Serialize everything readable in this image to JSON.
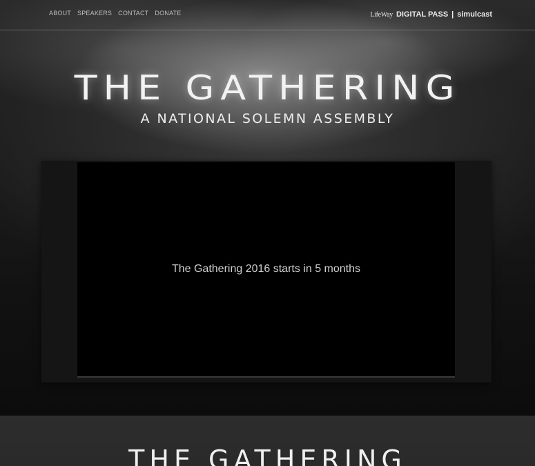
{
  "nav": {
    "items": [
      {
        "label": "ABOUT"
      },
      {
        "label": "SPEAKERS"
      },
      {
        "label": "CONTACT"
      },
      {
        "label": "DONATE"
      }
    ]
  },
  "brand": {
    "lifeway": "LifeWay",
    "digital_pass": "DIGITAL PASS",
    "separator": "|",
    "simulcast": "simulcast"
  },
  "hero": {
    "title": "THE GATHERING",
    "subtitle": "A NATIONAL SOLEMN ASSEMBLY"
  },
  "player": {
    "countdown": "The Gathering 2016 starts in 5 months"
  },
  "footer": {
    "title": "THE GATHERING"
  },
  "colors": {
    "background": "#1a1a1a",
    "player_bg": "#000000",
    "text": "#f2f2f2"
  }
}
